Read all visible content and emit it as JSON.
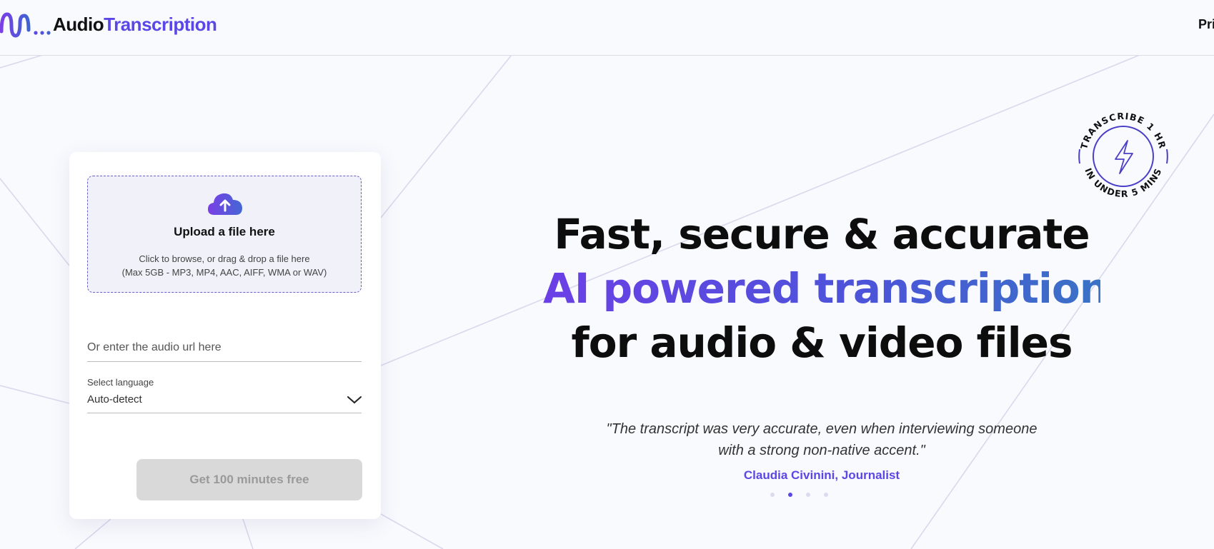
{
  "header": {
    "logo_part1": "Audio",
    "logo_part2": "Transcription",
    "nav_item": "Pricing"
  },
  "upload": {
    "icon": "cloud-upload-icon",
    "title": "Upload a file here",
    "subtitle_line1": "Click to browse, or drag & drop a file here",
    "subtitle_line2": "(Max 5GB - MP3, MP4, AAC, AIFF, WMA or WAV)"
  },
  "url_input": {
    "value": "",
    "placeholder": "Or enter the audio url here"
  },
  "language": {
    "label": "Select language",
    "selected": "Auto-detect"
  },
  "cta": {
    "label": "Get 100 minutes free"
  },
  "badge": {
    "top_text": "TRANSCRIBE 1 HR",
    "bottom_text": "IN UNDER 5 MINS",
    "icon": "lightning-icon"
  },
  "hero": {
    "line1": "Fast, secure & accurate",
    "line2": "AI powered transcription",
    "line3": "for audio & video files"
  },
  "testimonial": {
    "quote_line1": "\"The transcript was very accurate, even when interviewing someone",
    "quote_line2": "with a strong non-native accent.\"",
    "author": "Claudia Civinini, Journalist"
  },
  "carousel": {
    "count": 4,
    "active_index": 1
  },
  "colors": {
    "accent": "#5a47e6",
    "accent_gradient_end": "#3a72c6",
    "background": "#f9fafe",
    "cta_disabled_bg": "#d9d9d9"
  }
}
